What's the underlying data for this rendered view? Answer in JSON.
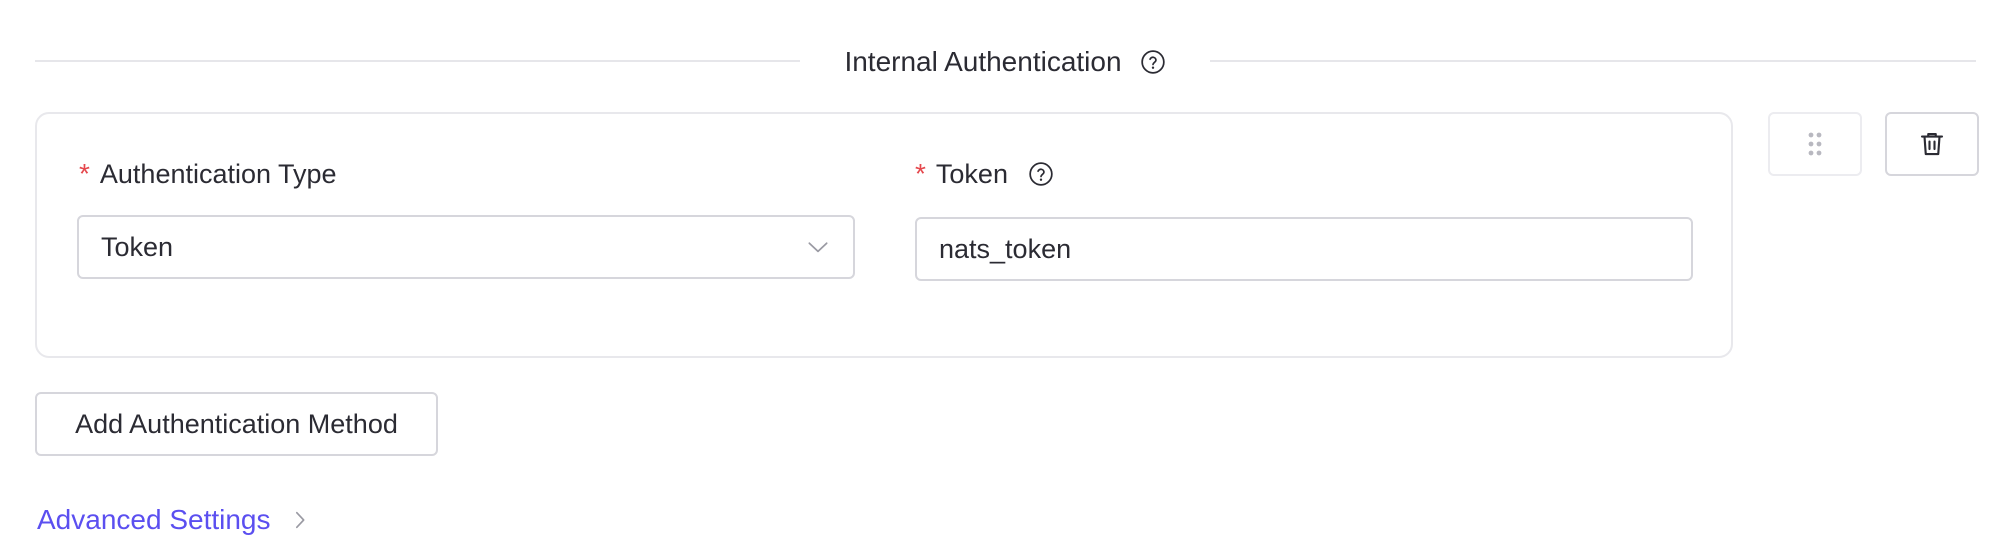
{
  "section": {
    "title": "Internal Authentication",
    "help_icon": "question-circle-icon"
  },
  "auth_card": {
    "auth_type": {
      "required_marker": "*",
      "label": "Authentication Type",
      "selected_value": "Token",
      "dropdown_icon": "chevron-down-icon"
    },
    "token": {
      "required_marker": "*",
      "label": "Token",
      "help_icon": "question-circle-icon",
      "value": "nats_token"
    },
    "drag_handle_icon": "drag-handle-icon",
    "delete_icon": "trash-icon"
  },
  "actions": {
    "add_method_label": "Add Authentication Method"
  },
  "advanced_settings": {
    "label": "Advanced Settings",
    "icon": "chevron-right-icon"
  },
  "colors": {
    "accent": "#5b4ff0",
    "required": "#e5484d",
    "border": "#d6d6dc",
    "text": "#2b2b33"
  }
}
